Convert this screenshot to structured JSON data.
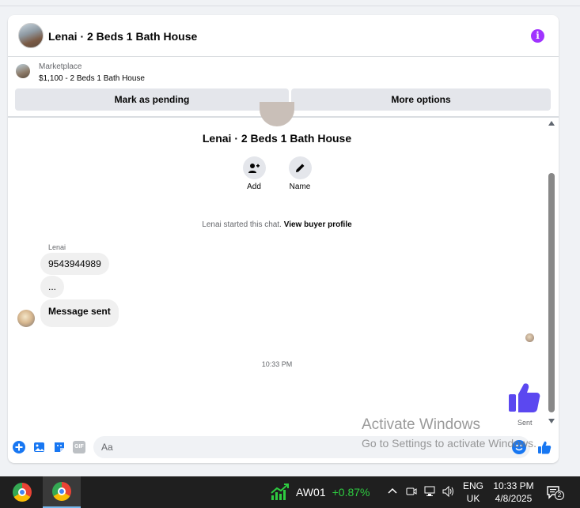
{
  "header": {
    "title": "Lenai · 2 Beds 1 Bath House",
    "info_icon": "i"
  },
  "listing": {
    "category": "Marketplace",
    "price_title": "$1,100 - 2 Beds 1 Bath House"
  },
  "buttons": {
    "mark_pending": "Mark as pending",
    "more_options": "More options"
  },
  "profile": {
    "name": "Lenai · 2 Beds 1 Bath House",
    "actions": [
      {
        "label": "Add",
        "icon": "add-person-icon"
      },
      {
        "label": "Name",
        "icon": "pencil-icon"
      }
    ]
  },
  "chat": {
    "started_text": "Lenai started this chat.",
    "view_profile_link": "View buyer profile",
    "sender": "Lenai",
    "messages": [
      "9543944989",
      "...",
      "Message sent"
    ],
    "timestamp": "10:33 PM",
    "like_status": "Sent"
  },
  "composer": {
    "placeholder": "Aa",
    "gif_label": "GIF"
  },
  "watermark": {
    "title": "Activate Windows",
    "subtitle": "Go to Settings to activate Windows."
  },
  "taskbar": {
    "stock_name": "AW01",
    "stock_change": "+0.87%",
    "language_top": "ENG",
    "language_bottom": "UK",
    "time": "10:33 PM",
    "date": "4/8/2025",
    "notification_count": "2"
  },
  "colors": {
    "messenger_blue": "#1877f2",
    "like_purple": "#5b48f0",
    "info_purple": "#a033ff",
    "stock_green": "#2ecc40"
  }
}
